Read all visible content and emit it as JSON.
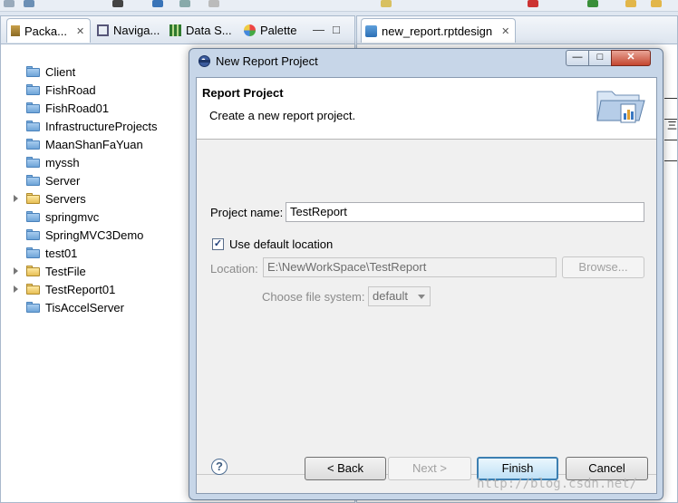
{
  "left_view": {
    "tabs": [
      {
        "label": "Packa...",
        "close": "✕"
      },
      {
        "label": "Naviga..."
      },
      {
        "label": "Data S..."
      },
      {
        "label": "Palette"
      }
    ],
    "view_controls": [
      "—",
      "□"
    ],
    "tree": [
      {
        "label": "Client",
        "expandable": false
      },
      {
        "label": "FishRoad",
        "expandable": false
      },
      {
        "label": "FishRoad01",
        "expandable": false
      },
      {
        "label": "InfrastructureProjects",
        "expandable": false
      },
      {
        "label": "MaanShanFaYuan",
        "expandable": false
      },
      {
        "label": "myssh",
        "expandable": false
      },
      {
        "label": "Server",
        "expandable": false
      },
      {
        "label": "Servers",
        "expandable": true
      },
      {
        "label": "springmvc",
        "expandable": false
      },
      {
        "label": "SpringMVC3Demo",
        "expandable": false
      },
      {
        "label": "test01",
        "expandable": false
      },
      {
        "label": "TestFile",
        "expandable": true
      },
      {
        "label": "TestReport01",
        "expandable": true
      },
      {
        "label": "TisAccelServer",
        "expandable": false
      }
    ]
  },
  "editor": {
    "tab_label": "new_report.rptdesign",
    "tab_close": "✕",
    "edge_glyph": "三"
  },
  "dialog": {
    "title": "New Report Project",
    "win_min": "—",
    "win_max": "□",
    "win_close": "✕",
    "banner_title": "Report Project",
    "banner_subtitle": "Create a new report project.",
    "project_name_label": "Project name:",
    "project_name_value": "TestReport",
    "use_default_label": "Use default location",
    "use_default_checked": "✓",
    "location_label": "Location:",
    "location_value": "E:\\NewWorkSpace\\TestReport",
    "browse_label": "Browse...",
    "file_system_label": "Choose file system:",
    "file_system_value": "default",
    "help_label": "?",
    "back_label": "< Back",
    "next_label": "Next >",
    "finish_label": "Finish",
    "cancel_label": "Cancel"
  },
  "watermark": "http://blog.csdn.net/"
}
